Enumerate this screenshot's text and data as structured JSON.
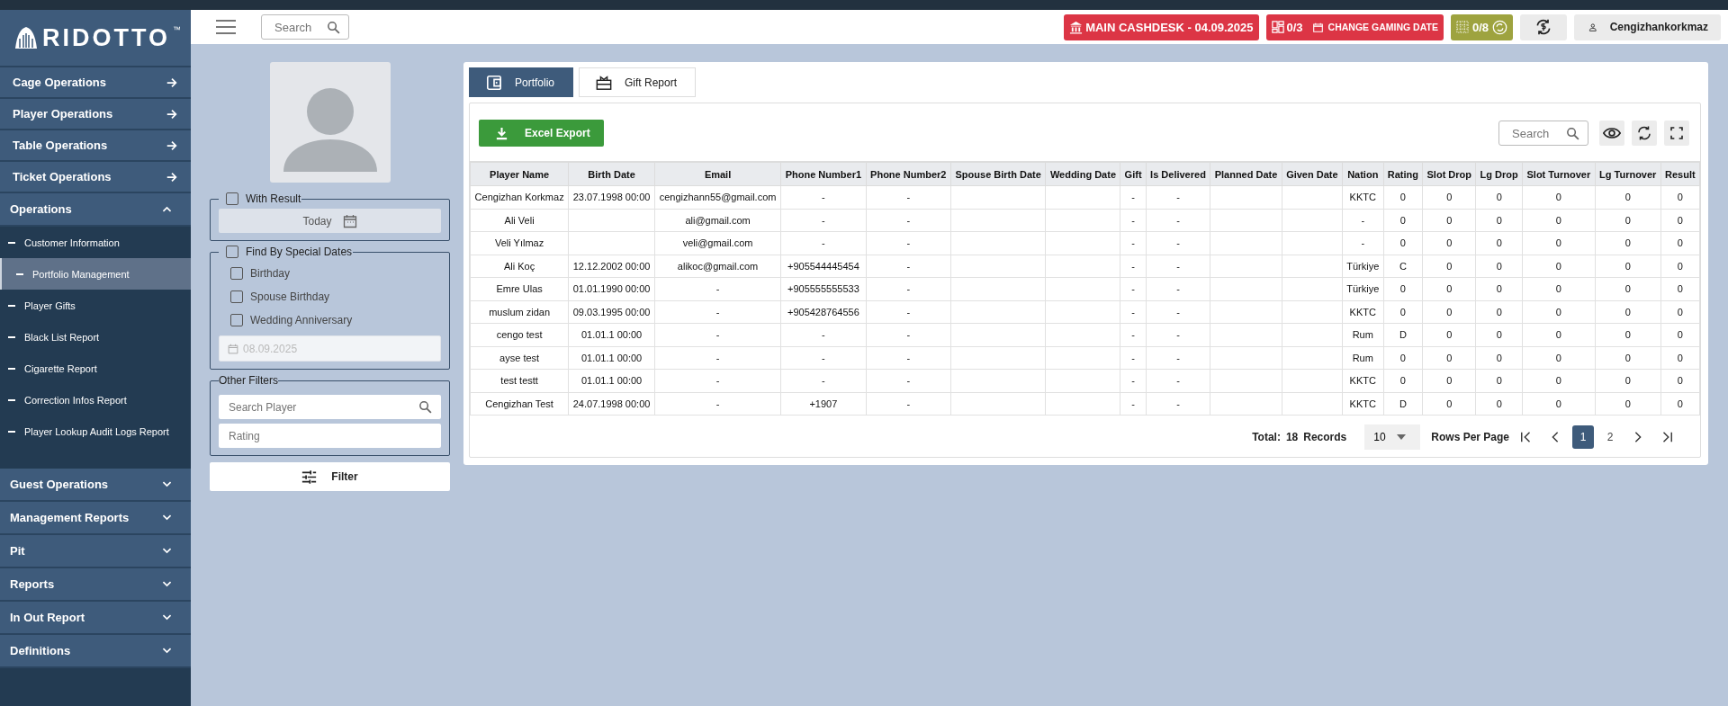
{
  "sidebar": {
    "logo": {
      "name": "RIDOTTO",
      "mark": "™"
    },
    "items": [
      {
        "kind": "link",
        "label": "Cage Operations"
      },
      {
        "kind": "link",
        "label": "Player Operations"
      },
      {
        "kind": "link",
        "label": "Table Operations"
      },
      {
        "kind": "link",
        "label": "Ticket Operations"
      },
      {
        "kind": "group",
        "label": "Operations",
        "expanded": true,
        "children": [
          {
            "label": "Customer Information",
            "selected": false
          },
          {
            "label": "Portfolio Management",
            "selected": true
          },
          {
            "label": "Player Gifts",
            "selected": false
          },
          {
            "label": "Black List Report",
            "selected": false
          },
          {
            "label": "Cigarette Report",
            "selected": false
          },
          {
            "label": "Correction Infos Report",
            "selected": false
          },
          {
            "label": "Player Lookup Audit Logs Report",
            "selected": false
          }
        ]
      },
      {
        "kind": "group",
        "label": "Guest Operations",
        "expanded": false
      },
      {
        "kind": "group",
        "label": "Management Reports",
        "expanded": false
      },
      {
        "kind": "group",
        "label": "Pit",
        "expanded": false
      },
      {
        "kind": "group",
        "label": "Reports",
        "expanded": false
      },
      {
        "kind": "group",
        "label": "In Out Report",
        "expanded": false
      },
      {
        "kind": "group",
        "label": "Definitions",
        "expanded": false
      }
    ]
  },
  "topbar": {
    "search": {
      "placeholder": "Search"
    },
    "cashdesk": "MAIN CASHDESK - 04.09.2025",
    "tables": "0/3",
    "gaming_date": "CHANGE GAMING DATE",
    "slots": "0/8",
    "user": "Cengizhankorkmaz"
  },
  "filters": {
    "with_result": {
      "label": "With Result",
      "checked": false,
      "date": "Today"
    },
    "special_dates": {
      "label": "Find By Special Dates",
      "checked": false,
      "options": [
        {
          "label": "Birthday",
          "checked": false
        },
        {
          "label": "Spouse Birthday",
          "checked": false
        },
        {
          "label": "Wedding Anniversary",
          "checked": false
        }
      ],
      "date": "08.09.2025"
    },
    "other": {
      "legend": "Other Filters",
      "search": {
        "placeholder": "Search Player"
      },
      "rating": {
        "placeholder": "Rating"
      }
    },
    "button": "Filter"
  },
  "tabs": [
    {
      "label": "Portfolio",
      "selected": true
    },
    {
      "label": "Gift Report",
      "selected": false
    }
  ],
  "toolbar": {
    "export": "Excel Export",
    "search": {
      "placeholder": "Search"
    }
  },
  "table": {
    "columns": [
      "Player Name",
      "Birth Date",
      "Email",
      "Phone Number1",
      "Phone Number2",
      "Spouse Birth Date",
      "Wedding Date",
      "Gift",
      "Is Delivered",
      "Planned Date",
      "Given Date",
      "Nation",
      "Rating",
      "Slot Drop",
      "Lg Drop",
      "Slot Turnover",
      "Lg Turnover",
      "Result"
    ],
    "rows": [
      [
        "Cengizhan Korkmaz",
        "23.07.1998 00:00",
        "cengizhann55@gmail.com",
        "-",
        "-",
        "",
        "",
        "-",
        "-",
        "",
        "",
        "KKTC",
        "0",
        "0",
        "0",
        "0",
        "0",
        "0"
      ],
      [
        "Ali Veli",
        "",
        "ali@gmail.com",
        "-",
        "-",
        "",
        "",
        "-",
        "-",
        "",
        "",
        "-",
        "0",
        "0",
        "0",
        "0",
        "0",
        "0"
      ],
      [
        "Veli Yılmaz",
        "",
        "veli@gmail.com",
        "-",
        "-",
        "",
        "",
        "-",
        "-",
        "",
        "",
        "-",
        "0",
        "0",
        "0",
        "0",
        "0",
        "0"
      ],
      [
        "Ali Koç",
        "12.12.2002 00:00",
        "alikoc@gmail.com",
        "+905544445454",
        "-",
        "",
        "",
        "-",
        "-",
        "",
        "",
        "Türkiye",
        "C",
        "0",
        "0",
        "0",
        "0",
        "0"
      ],
      [
        "Emre Ulas",
        "01.01.1990 00:00",
        "-",
        "+905555555533",
        "-",
        "",
        "",
        "-",
        "-",
        "",
        "",
        "Türkiye",
        "0",
        "0",
        "0",
        "0",
        "0",
        "0"
      ],
      [
        "muslum zidan",
        "09.03.1995 00:00",
        "-",
        "+905428764556",
        "-",
        "",
        "",
        "-",
        "-",
        "",
        "",
        "KKTC",
        "0",
        "0",
        "0",
        "0",
        "0",
        "0"
      ],
      [
        "cengo test",
        "01.01.1 00:00",
        "-",
        "-",
        "-",
        "",
        "",
        "-",
        "-",
        "",
        "",
        "Rum",
        "D",
        "0",
        "0",
        "0",
        "0",
        "0"
      ],
      [
        "ayse test",
        "01.01.1 00:00",
        "-",
        "-",
        "-",
        "",
        "",
        "-",
        "-",
        "",
        "",
        "Rum",
        "0",
        "0",
        "0",
        "0",
        "0",
        "0"
      ],
      [
        "test testt",
        "01.01.1 00:00",
        "-",
        "-",
        "-",
        "",
        "",
        "-",
        "-",
        "",
        "",
        "KKTC",
        "0",
        "0",
        "0",
        "0",
        "0",
        "0"
      ],
      [
        "Cengizhan Test",
        "24.07.1998 00:00",
        "-",
        "+1907",
        "-",
        "",
        "",
        "-",
        "-",
        "",
        "",
        "KKTC",
        "D",
        "0",
        "0",
        "0",
        "0",
        "0"
      ]
    ]
  },
  "pagination": {
    "total_label": "Total:",
    "total": "18",
    "records_label": "Records",
    "rows_per_page": "10",
    "rows_per_page_label": "Rows Per Page",
    "pages": [
      {
        "label": "1",
        "selected": true
      },
      {
        "label": "2",
        "selected": false
      }
    ]
  }
}
